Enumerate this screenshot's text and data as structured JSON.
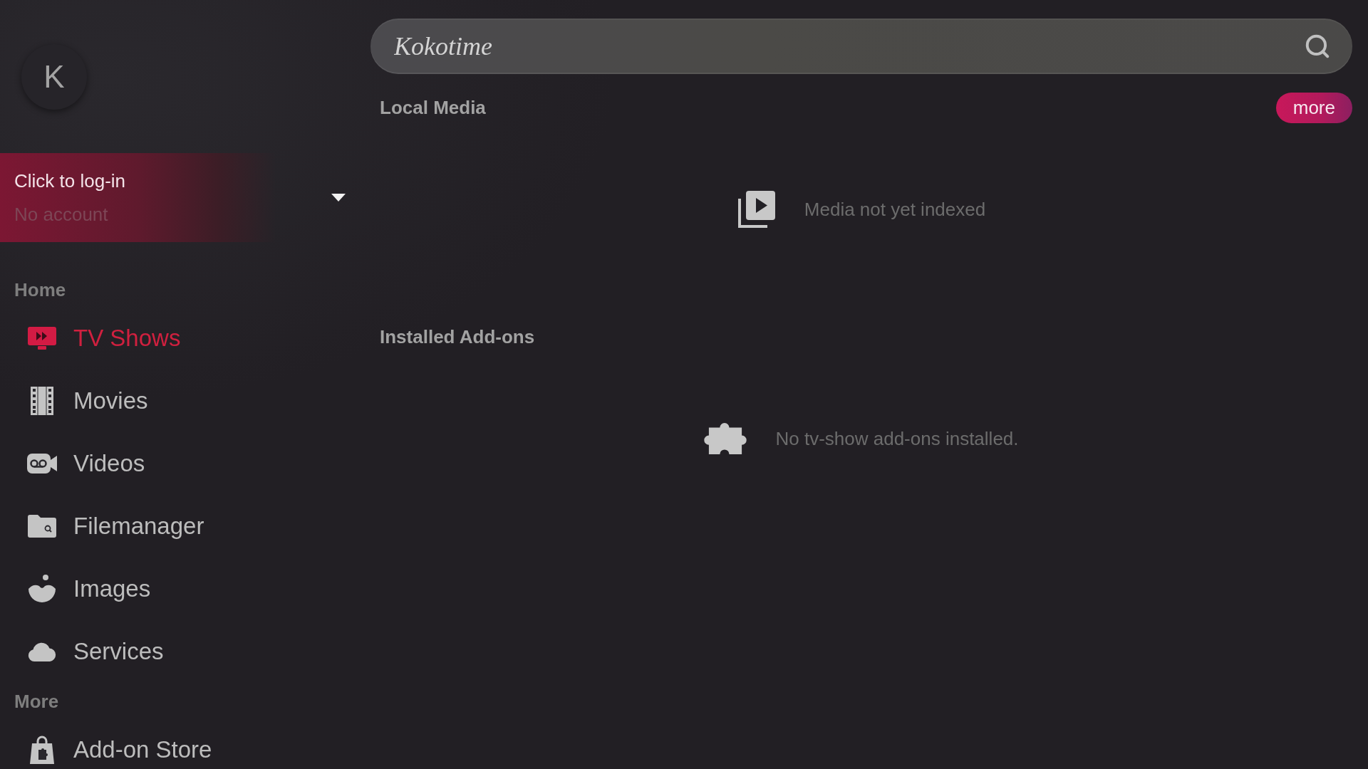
{
  "profile": {
    "initial": "K"
  },
  "account": {
    "title": "Click to log-in",
    "subtitle": "No account"
  },
  "sidebar": {
    "sections": [
      {
        "title": "Home",
        "items": [
          {
            "label": "TV Shows",
            "selected": true
          },
          {
            "label": "Movies",
            "selected": false
          },
          {
            "label": "Videos",
            "selected": false
          },
          {
            "label": "Filemanager",
            "selected": false
          },
          {
            "label": "Images",
            "selected": false
          },
          {
            "label": "Services",
            "selected": false
          }
        ]
      },
      {
        "title": "More",
        "items": [
          {
            "label": "Add-on Store",
            "selected": false
          }
        ]
      }
    ]
  },
  "search": {
    "placeholder": "Kokotime"
  },
  "sections": [
    {
      "title": "Local Media",
      "action": "more",
      "message": "Media not yet indexed"
    },
    {
      "title": "Installed Add-ons",
      "message": "No tv-show add-ons installed."
    }
  ]
}
